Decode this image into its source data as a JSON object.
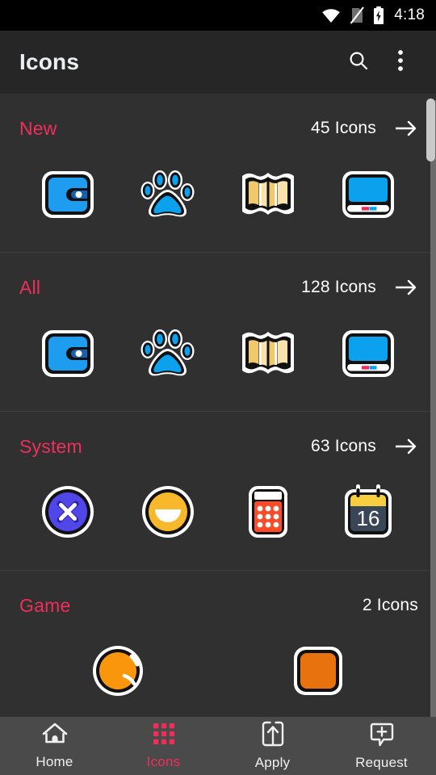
{
  "statusbar": {
    "time": "4:18",
    "icons": [
      "wifi-icon",
      "no-sim-icon",
      "battery-charging-icon"
    ]
  },
  "appbar": {
    "title": "Icons",
    "search_icon": "search-icon",
    "overflow_icon": "overflow-menu-icon"
  },
  "theme": {
    "background": "#303030",
    "appbar_bg": "#262626",
    "statusbar_bg": "#000000",
    "accent_pink": "#ef2e5b",
    "nav_bg": "#4a4a4a",
    "text_primary": "#ffffff",
    "divider": "#3d3d3d",
    "scrollbar_thumb": "#c9c9c9"
  },
  "sections": [
    {
      "title": "New",
      "count": "45 Icons",
      "has_arrow": true,
      "icons": [
        "wallet-icon",
        "paw-print-icon",
        "map-icon",
        "laptop-icon"
      ]
    },
    {
      "title": "All",
      "count": "128 Icons",
      "has_arrow": true,
      "icons": [
        "wallet-icon",
        "paw-print-icon",
        "map-icon",
        "laptop-icon"
      ]
    },
    {
      "title": "System",
      "count": "63 Icons",
      "has_arrow": true,
      "icons": [
        "close-circle-icon",
        "smiley-face-icon",
        "calculator-icon",
        "calendar-16-icon"
      ]
    },
    {
      "title": "Game",
      "count": "2 Icons",
      "has_arrow": false,
      "icons": [
        "orange-ball-icon",
        "orange-card-icon"
      ]
    }
  ],
  "bottomnav": {
    "items": [
      {
        "label": "Home",
        "icon": "home-icon",
        "active": false
      },
      {
        "label": "Icons",
        "icon": "grid-icon",
        "active": true
      },
      {
        "label": "Apply",
        "icon": "apply-icon",
        "active": false
      },
      {
        "label": "Request",
        "icon": "request-icon",
        "active": false
      }
    ]
  }
}
